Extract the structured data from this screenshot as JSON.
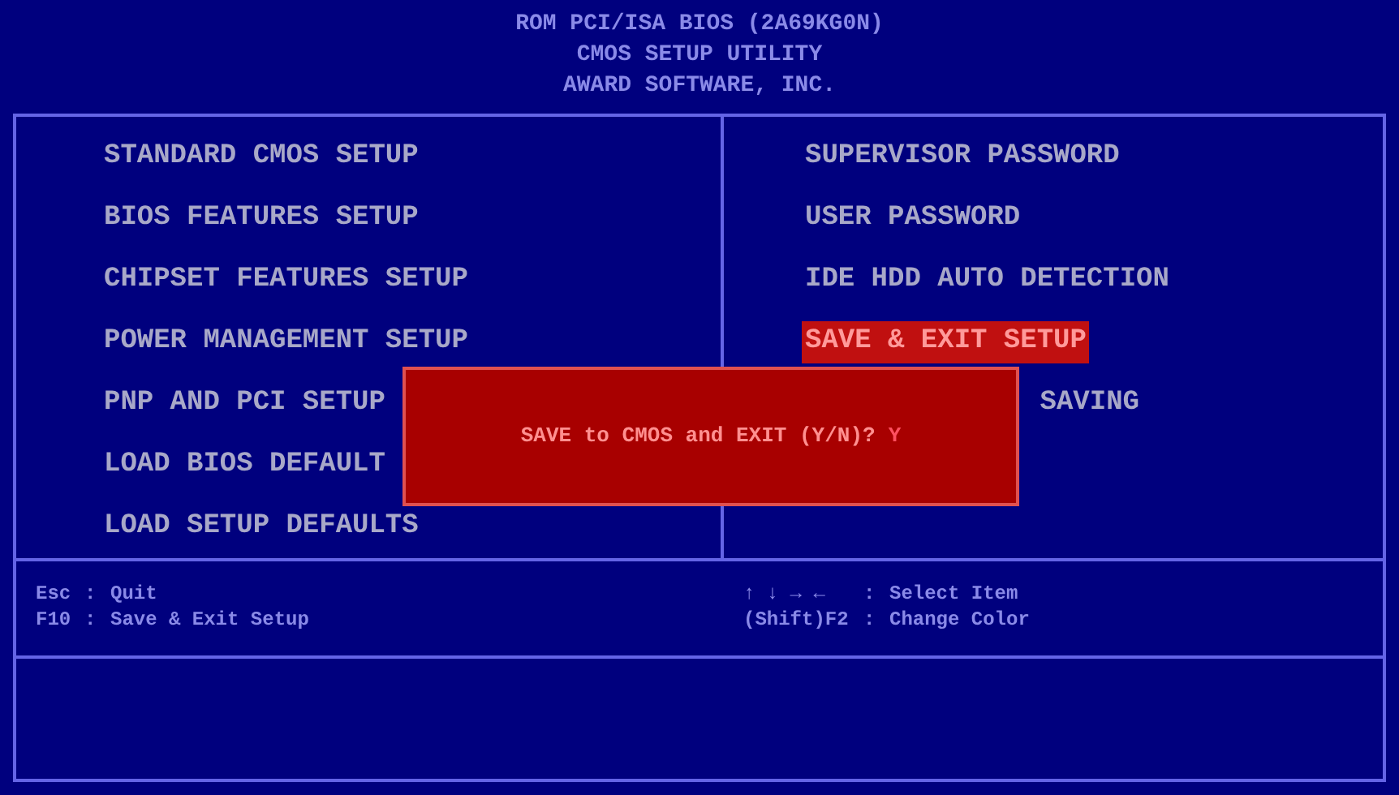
{
  "header": {
    "lines": [
      "ROM PCI/ISA BIOS (2A69KG0N)",
      "CMOS SETUP UTILITY",
      "AWARD SOFTWARE, INC."
    ]
  },
  "menu": {
    "left": [
      {
        "label": "STANDARD CMOS SETUP",
        "selected": false
      },
      {
        "label": "BIOS FEATURES SETUP",
        "selected": false
      },
      {
        "label": "CHIPSET FEATURES SETUP",
        "selected": false
      },
      {
        "label": "POWER MANAGEMENT SETUP",
        "selected": false
      },
      {
        "label": "PNP AND PCI SETUP",
        "selected": false
      },
      {
        "label": "LOAD BIOS DEFAULT",
        "selected": false
      },
      {
        "label": "LOAD SETUP DEFAULTS",
        "selected": false
      }
    ],
    "right": [
      {
        "label": "SUPERVISOR PASSWORD",
        "selected": false,
        "kind": "full"
      },
      {
        "label": "USER PASSWORD",
        "selected": false,
        "kind": "full"
      },
      {
        "label": "IDE HDD AUTO DETECTION",
        "selected": false,
        "kind": "full"
      },
      {
        "label": "SAVE & EXIT SETUP",
        "selected": true,
        "kind": "full"
      },
      {
        "label": "SAVING",
        "selected": false,
        "kind": "tail"
      }
    ]
  },
  "dialog": {
    "prompt": "SAVE to CMOS and EXIT (Y/N)?",
    "answer": "Y"
  },
  "footer": {
    "left": [
      {
        "key": "Esc",
        "sep": ":",
        "action": "Quit"
      },
      {
        "key": "F10",
        "sep": ":",
        "action": "Save & Exit Setup"
      }
    ],
    "right": [
      {
        "key": "↑ ↓ → ←",
        "sep": ":",
        "action": "Select Item"
      },
      {
        "key": "(Shift)F2",
        "sep": ":",
        "action": "Change Color"
      }
    ]
  }
}
